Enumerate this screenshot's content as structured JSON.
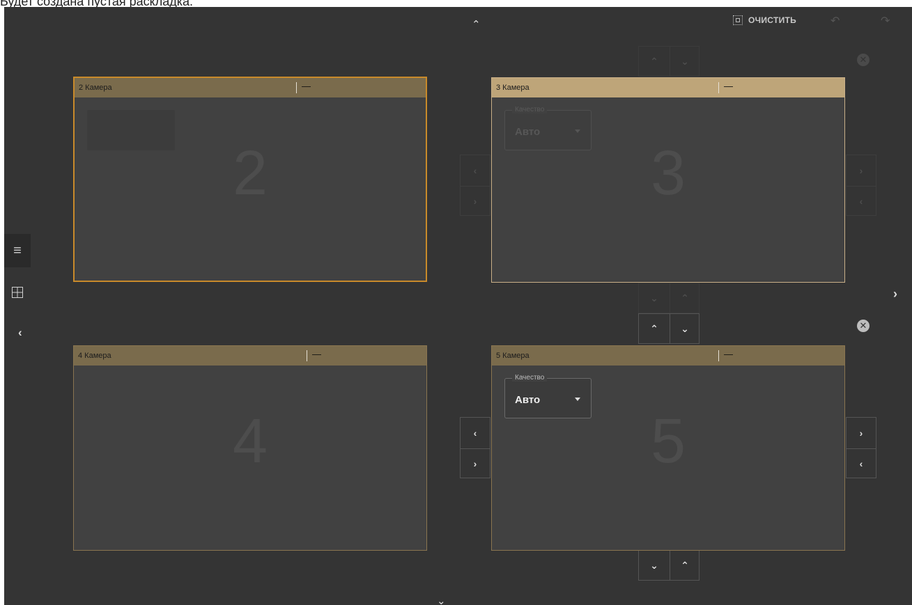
{
  "caption": {
    "text": "Будет создана пустая раскладка."
  },
  "toolbar": {
    "clear_label": "ОЧИСТИТЬ",
    "clear_icon": "select-clear-icon",
    "undo_icon": "undo-icon",
    "redo_icon": "redo-icon"
  },
  "nav": {
    "up": "⌃",
    "down": "⌄",
    "right": "›",
    "left": "‹"
  },
  "sidebar": {
    "menu_icon": "≡",
    "grid_icon": "grid-icon",
    "collapse": "‹"
  },
  "cameras": [
    {
      "title": "2 Камера",
      "min": "—",
      "number": "2",
      "state": "active"
    },
    {
      "title": "3 Камера",
      "min": "—",
      "number": "3",
      "quality_label": "Качество",
      "quality_value": "Авто"
    },
    {
      "title": "4 Камера",
      "min": "—",
      "number": "4"
    },
    {
      "title": "5 Камера",
      "min": "—",
      "number": "5",
      "quality_label": "Качество",
      "quality_value": "Авто"
    }
  ],
  "controls": {
    "left": "‹",
    "right": "›",
    "up": "⌃",
    "down": "⌄",
    "close": "✕"
  },
  "colors": {
    "background": "#343434",
    "active_border": "#c98a2a",
    "header": "#7a6b4c",
    "header_selected": "#bea579"
  }
}
